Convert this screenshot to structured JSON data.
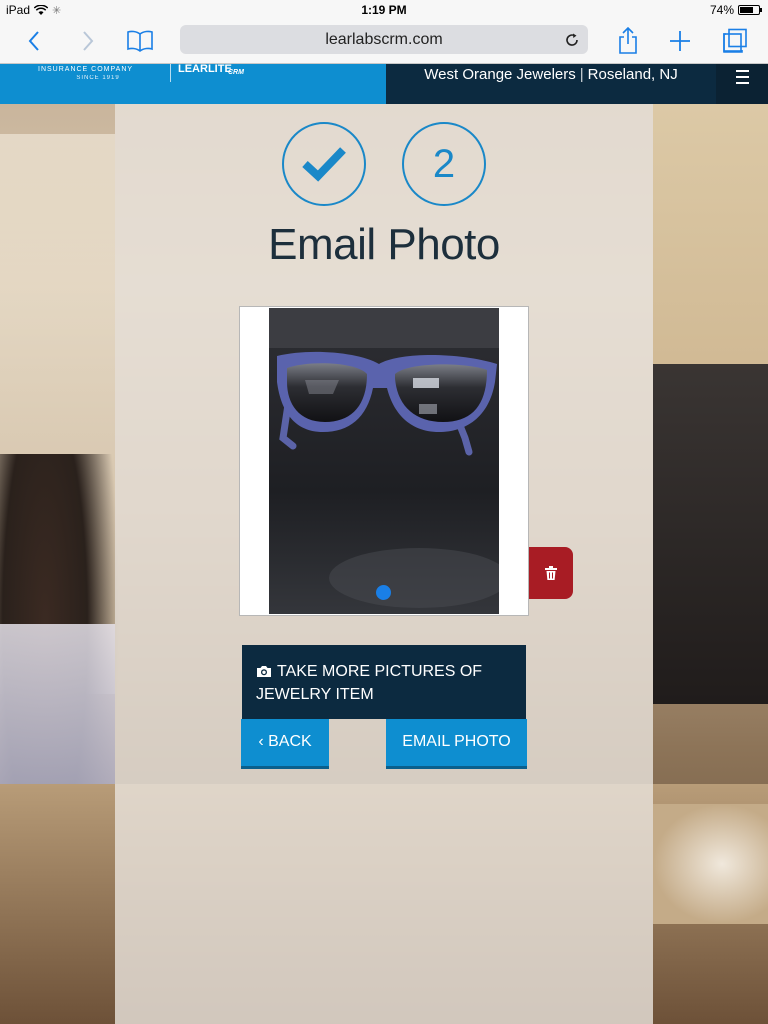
{
  "status_bar": {
    "device": "iPad",
    "time": "1:19 PM",
    "battery": "74%",
    "battery_level": 0.74
  },
  "browser": {
    "url": "learlabscrm.com",
    "icons": {
      "back": "chevron-left-icon",
      "forward": "chevron-right-icon",
      "bookmarks": "book-icon",
      "reload": "reload-icon",
      "share": "share-icon",
      "new_tab": "plus-icon",
      "tabs": "tabs-icon"
    }
  },
  "header": {
    "brand_tagline": "INSURANCE COMPANY",
    "brand_since": "SINCE 1919",
    "brand_logo": "LEARLITE",
    "brand_suffix": "CRM",
    "store_name": "West Orange Jewelers",
    "store_location": "Roseland, NJ",
    "menu_icon": "hamburger-icon",
    "colors": {
      "brand_blue": "#0e8ed0",
      "navy": "#0c2a40"
    }
  },
  "steps": [
    {
      "state": "complete",
      "icon": "checkmark-icon"
    },
    {
      "state": "current",
      "label": "2"
    }
  ],
  "page": {
    "title": "Email Photo"
  },
  "photo": {
    "subject": "blue sunglasses on dark surface",
    "slide_count": 1,
    "active_slide": 1,
    "delete_icon": "trash-icon",
    "delete_color": "#a81c24"
  },
  "actions": {
    "take_more_label": "TAKE MORE PICTURES OF JEWELRY ITEM",
    "take_more_icon": "camera-icon",
    "back_label": "BACK",
    "back_icon": "chevron-left-icon",
    "email_label": "EMAIL PHOTO"
  }
}
